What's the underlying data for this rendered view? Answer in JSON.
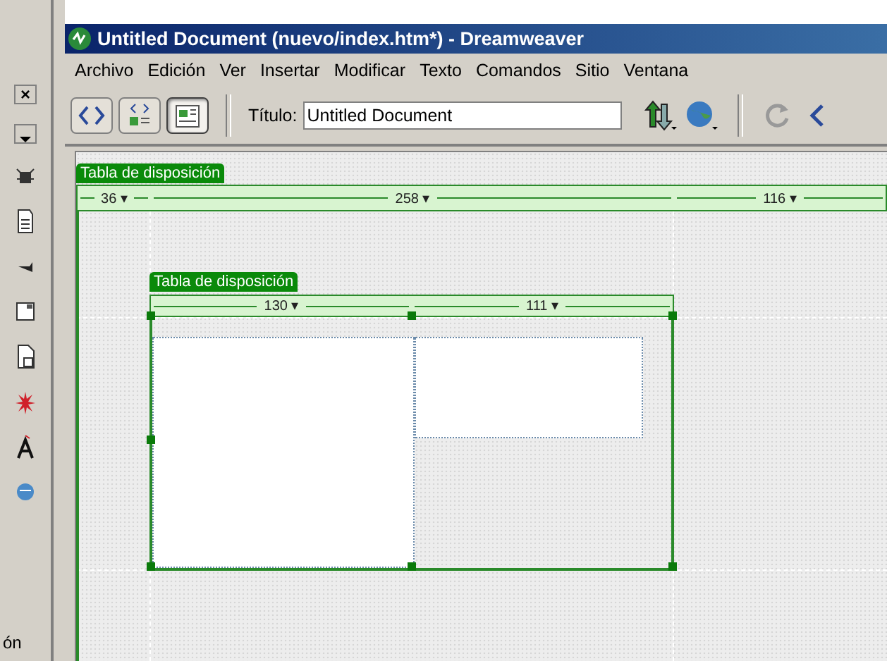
{
  "palette": {
    "close": "×",
    "label": "ón"
  },
  "window": {
    "title": "Untitled Document (nuevo/index.htm*) - Dreamweaver"
  },
  "menu": [
    "Archivo",
    "Edición",
    "Ver",
    "Insertar",
    "Modificar",
    "Texto",
    "Comandos",
    "Sitio",
    "Ventana"
  ],
  "toolbar": {
    "views": [
      {
        "kind": "code",
        "selected": false
      },
      {
        "kind": "split",
        "selected": false
      },
      {
        "kind": "design",
        "selected": true
      }
    ],
    "title_label": "Título:",
    "title_value": "Untitled Document"
  },
  "layout_tables": [
    {
      "kind": "outer",
      "label": "Tabla de disposición",
      "columns": [
        "36 ▾",
        "258 ▾",
        "116 ▾"
      ]
    },
    {
      "kind": "inner",
      "label": "Tabla de disposición",
      "columns": [
        "130 ▾",
        "111 ▾"
      ]
    }
  ]
}
